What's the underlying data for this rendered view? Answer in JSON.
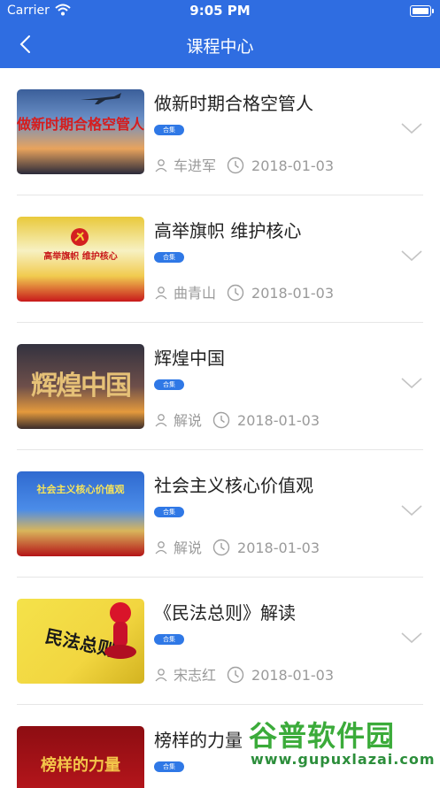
{
  "status_bar": {
    "carrier": "Carrier",
    "time": "9:05 PM"
  },
  "header": {
    "title": "课程中心",
    "back_icon": "chevron-left-icon"
  },
  "courses": [
    {
      "title": "做新时期合格空管人",
      "tag": "合集",
      "author": "车进军",
      "date": "2018-01-03",
      "thumb_text": "做新时期合格空管人"
    },
    {
      "title": "高举旗帜 维护核心",
      "tag": "合集",
      "author": "曲青山",
      "date": "2018-01-03",
      "thumb_text": "高举旗帜 维护核心"
    },
    {
      "title": "辉煌中国",
      "tag": "合集",
      "author": "解说",
      "date": "2018-01-03",
      "thumb_text": "辉煌中国"
    },
    {
      "title": "社会主义核心价值观",
      "tag": "合集",
      "author": "解说",
      "date": "2018-01-03",
      "thumb_text": "社会主义核心价值观"
    },
    {
      "title": "《民法总则》解读",
      "tag": "合集",
      "author": "宋志红",
      "date": "2018-01-03",
      "thumb_text": "民法总则"
    },
    {
      "title": "榜样的力量",
      "tag": "合集",
      "author": "",
      "date": "",
      "thumb_text": "榜样的力量"
    }
  ],
  "watermark": {
    "name": "谷普软件园",
    "url": "www.gupuxlazai.com"
  },
  "colors": {
    "header_bg": "#2f6de1",
    "tag_bg": "#2f78e6",
    "meta_text": "#9a9a9a"
  }
}
